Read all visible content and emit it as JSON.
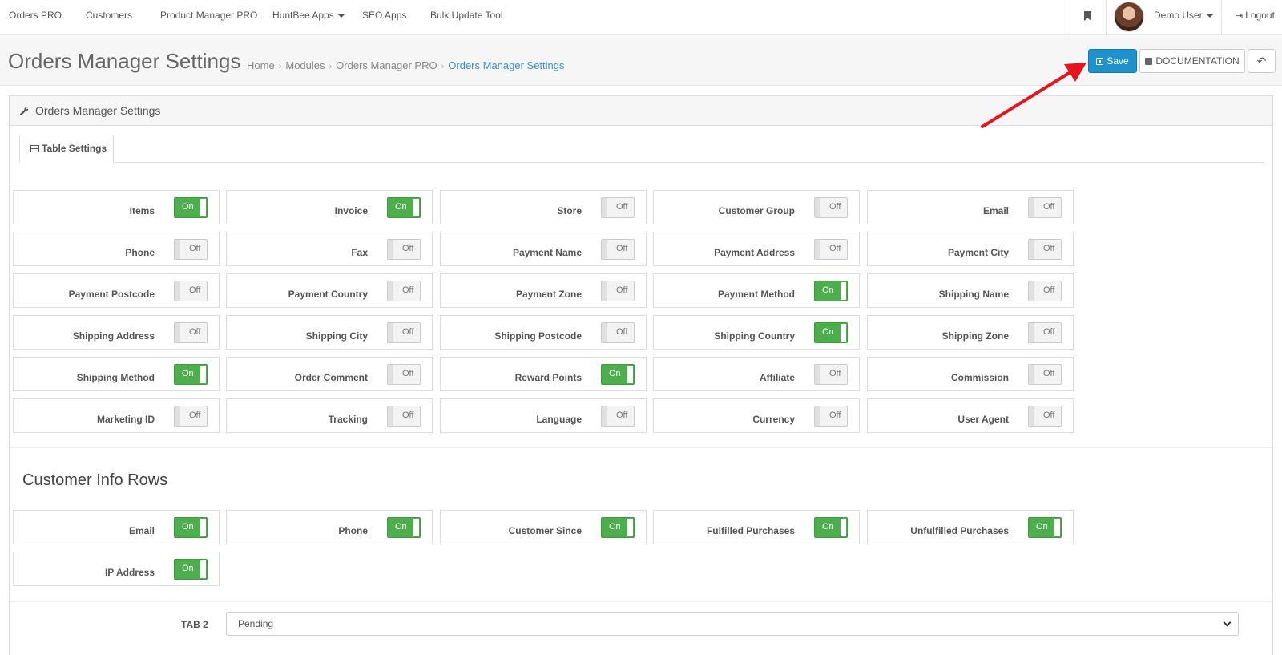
{
  "topnav": {
    "items": [
      "Orders PRO",
      "Customers",
      "Product Manager PRO",
      "HuntBee Apps",
      "SEO Apps",
      "Bulk Update Tool"
    ],
    "user": "Demo User",
    "logout": "Logout"
  },
  "header": {
    "title": "Orders Manager Settings",
    "breadcrumb": [
      "Home",
      "Modules",
      "Orders Manager PRO",
      "Orders Manager Settings"
    ],
    "save_label": "Save",
    "doc_label": "DOCUMENTATION",
    "back_glyph": "↶"
  },
  "panel": {
    "title": "Orders Manager Settings",
    "tab_label": "Table Settings"
  },
  "toggles": {
    "on_text": "On",
    "off_text": "Off"
  },
  "table_settings": [
    {
      "label": "Items",
      "on": true
    },
    {
      "label": "Invoice",
      "on": true
    },
    {
      "label": "Store",
      "on": false
    },
    {
      "label": "Customer Group",
      "on": false
    },
    {
      "label": "Email",
      "on": false
    },
    {
      "label": "Phone",
      "on": false
    },
    {
      "label": "Fax",
      "on": false
    },
    {
      "label": "Payment Name",
      "on": false
    },
    {
      "label": "Payment Address",
      "on": false
    },
    {
      "label": "Payment City",
      "on": false
    },
    {
      "label": "Payment Postcode",
      "on": false
    },
    {
      "label": "Payment Country",
      "on": false
    },
    {
      "label": "Payment Zone",
      "on": false
    },
    {
      "label": "Payment Method",
      "on": true
    },
    {
      "label": "Shipping Name",
      "on": false
    },
    {
      "label": "Shipping Address",
      "on": false
    },
    {
      "label": "Shipping City",
      "on": false
    },
    {
      "label": "Shipping Postcode",
      "on": false
    },
    {
      "label": "Shipping Country",
      "on": true
    },
    {
      "label": "Shipping Zone",
      "on": false
    },
    {
      "label": "Shipping Method",
      "on": true
    },
    {
      "label": "Order Comment",
      "on": false
    },
    {
      "label": "Reward Points",
      "on": true
    },
    {
      "label": "Affiliate",
      "on": false
    },
    {
      "label": "Commission",
      "on": false
    },
    {
      "label": "Marketing ID",
      "on": false
    },
    {
      "label": "Tracking",
      "on": false
    },
    {
      "label": "Language",
      "on": false
    },
    {
      "label": "Currency",
      "on": false
    },
    {
      "label": "User Agent",
      "on": false
    }
  ],
  "customer_info": {
    "heading": "Customer Info Rows",
    "items": [
      {
        "label": "Email",
        "on": true
      },
      {
        "label": "Phone",
        "on": true
      },
      {
        "label": "Customer Since",
        "on": true
      },
      {
        "label": "Fulfilled Purchases",
        "on": true
      },
      {
        "label": "Unfulfilled Purchases",
        "on": true
      },
      {
        "label": "IP Address",
        "on": true
      }
    ]
  },
  "tab2": {
    "label": "TAB 2",
    "selected": "Pending"
  },
  "colors": {
    "accent": "#1e91cf",
    "toggle_on": "#4cae4c",
    "annotation": "#e8141c"
  }
}
